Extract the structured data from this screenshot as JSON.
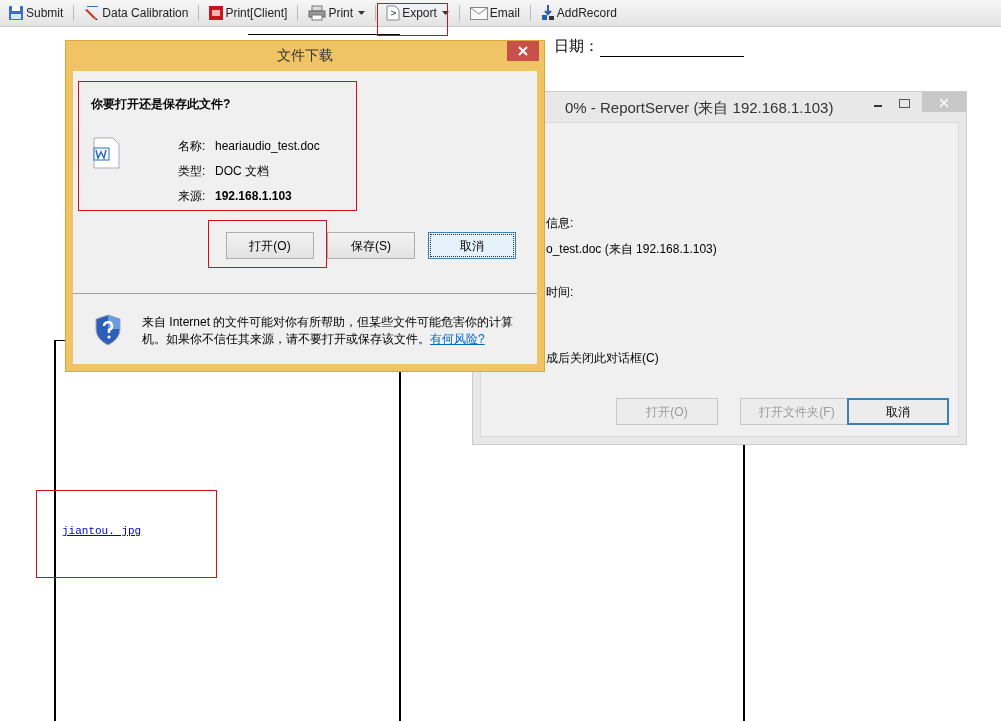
{
  "toolbar": {
    "items": [
      {
        "label": "Submit",
        "dropdown": false
      },
      {
        "label": "Data Calibration",
        "dropdown": false
      },
      {
        "label": "Print[Client]",
        "dropdown": false
      },
      {
        "label": "Print",
        "dropdown": true
      },
      {
        "label": "Export",
        "dropdown": true
      },
      {
        "label": "Email",
        "dropdown": false
      },
      {
        "label": "AddRecord",
        "dropdown": false
      }
    ]
  },
  "report": {
    "date_label": "日期：",
    "image_link": "jiantou. jpg"
  },
  "download_dialog": {
    "title": "文件下载",
    "question": "你要打开还是保存此文件?",
    "fields": [
      {
        "label": "名称:",
        "value": "heariaudio_test.doc",
        "emphasized": false
      },
      {
        "label": "类型:",
        "value": "DOC 文档",
        "emphasized": false
      },
      {
        "label": "来源:",
        "value": "192.168.1.103",
        "emphasized": true
      }
    ],
    "buttons": [
      {
        "label": "打开(O)",
        "focused": false
      },
      {
        "label": "保存(S)",
        "focused": false
      },
      {
        "label": "取消",
        "focused": true
      }
    ],
    "warning": "来自 Internet 的文件可能对你有所帮助，但某些文件可能危害你的计算机。如果你不信任其来源，请不要打开或保存该文件。",
    "warning_link": "有何风险?"
  },
  "progress_dialog": {
    "title": "0% - ReportServer (来自 192.168.1.103)",
    "lines": [
      "信息:",
      "o_test.doc (来自 192.168.1.103)",
      "时间:",
      "成后关闭此对话框(C)"
    ],
    "buttons": [
      {
        "label": "打开(O)",
        "disabled": true,
        "focused": false
      },
      {
        "label": "打开文件夹(F)",
        "disabled": true,
        "focused": false
      },
      {
        "label": "取消",
        "disabled": false,
        "focused": true
      }
    ]
  }
}
